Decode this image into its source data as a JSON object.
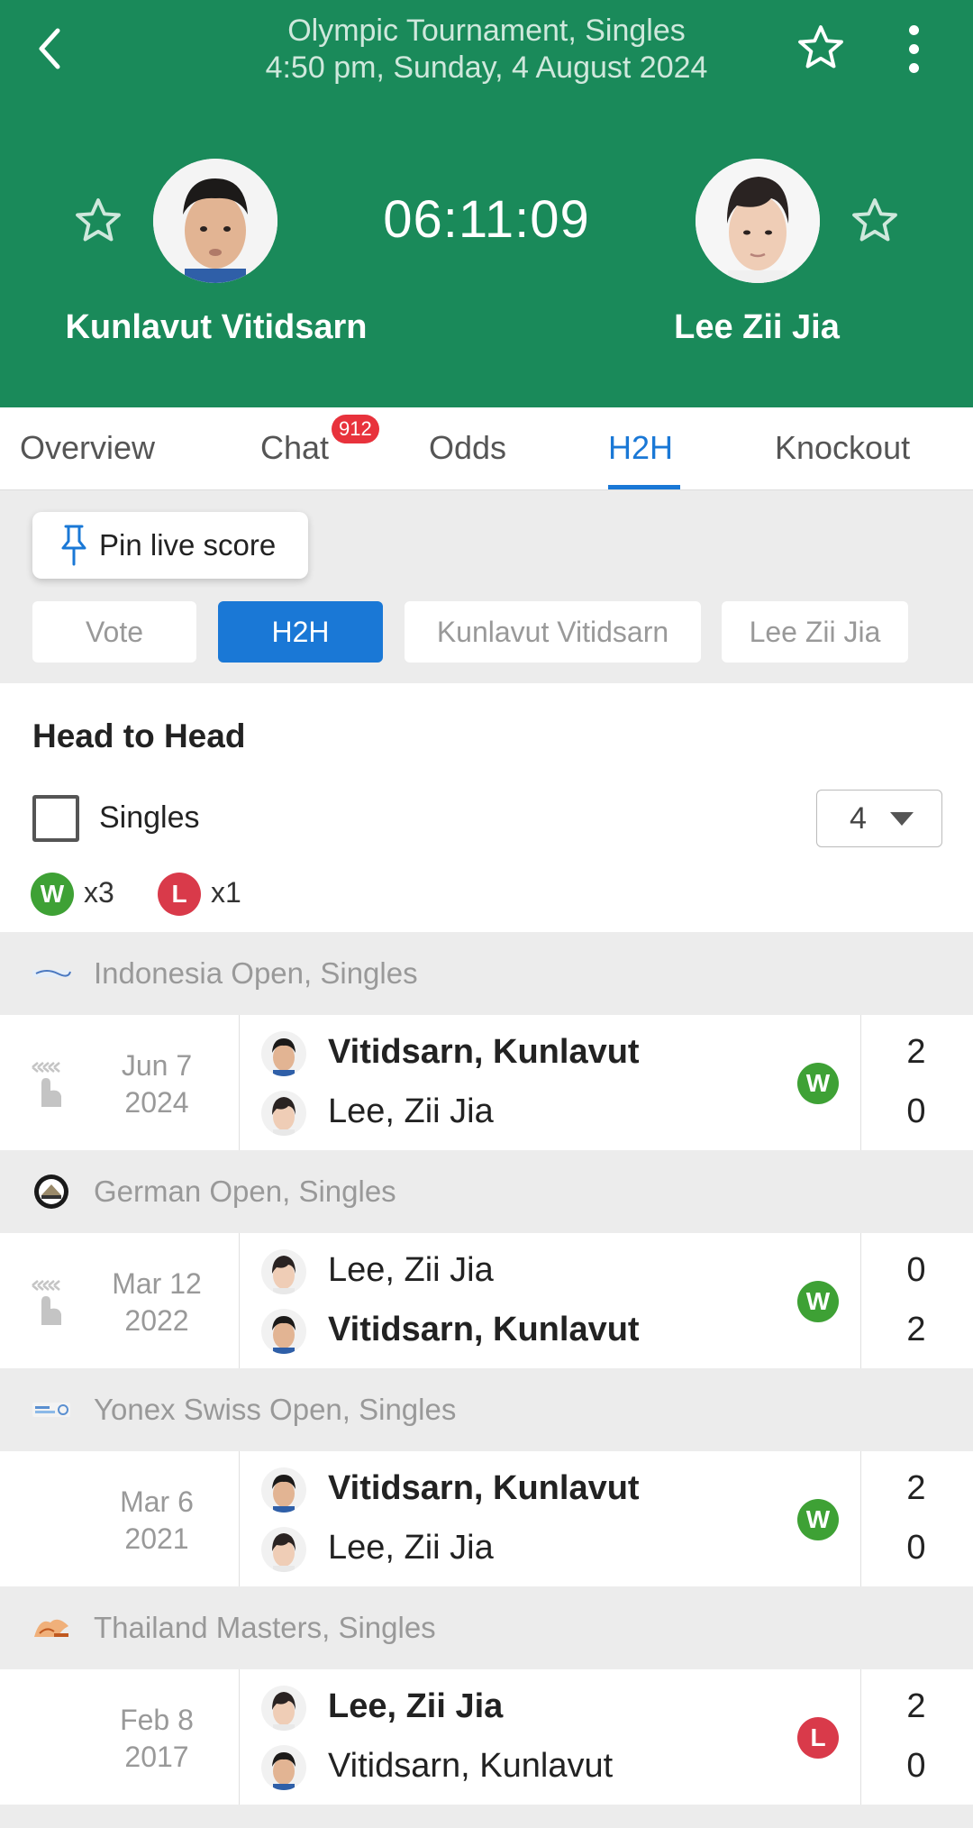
{
  "header": {
    "tournament_line": "Olympic Tournament, Singles",
    "datetime_line": "4:50 pm, Sunday, 4 August 2024",
    "countdown": "06:11:09",
    "player_left": "Kunlavut Vitidsarn",
    "player_right": "Lee Zii Jia",
    "colors": {
      "background": "#1a8a5a",
      "text": "#ffffff"
    },
    "icons": {
      "back": "back-arrow-icon",
      "favorite": "star-outline-icon",
      "more": "more-vertical-icon"
    }
  },
  "tabs": [
    {
      "label": "Overview",
      "active": false
    },
    {
      "label": "Chat",
      "active": false,
      "badge": "912"
    },
    {
      "label": "Odds",
      "active": false
    },
    {
      "label": "H2H",
      "active": true
    },
    {
      "label": "Knockout",
      "active": false
    }
  ],
  "pin_button": {
    "label": "Pin live score",
    "icon": "pin-icon"
  },
  "filter_chips": [
    {
      "label": "Vote",
      "active": false
    },
    {
      "label": "H2H",
      "active": true
    },
    {
      "label": "Kunlavut Vitidsarn",
      "active": false
    },
    {
      "label": "Lee Zii Jia",
      "active": false
    }
  ],
  "h2h": {
    "title": "Head to Head",
    "filter_label": "Singles",
    "filter_checked": false,
    "count_select": "4",
    "wins_badge": "W",
    "wins_count": "x3",
    "losses_badge": "L",
    "losses_count": "x1"
  },
  "matches": [
    {
      "tournament": "Indonesia Open, Singles",
      "date_line1": "Jun 7",
      "date_line2": "2024",
      "has_highlights_icon": true,
      "top_player": "Vitidsarn, Kunlavut",
      "top_score": "2",
      "top_winner": true,
      "bottom_player": "Lee, Zii Jia",
      "bottom_score": "0",
      "bottom_winner": false,
      "result": "W"
    },
    {
      "tournament": "German Open, Singles",
      "date_line1": "Mar 12",
      "date_line2": "2022",
      "has_highlights_icon": true,
      "top_player": "Lee, Zii Jia",
      "top_score": "0",
      "top_winner": false,
      "bottom_player": "Vitidsarn, Kunlavut",
      "bottom_score": "2",
      "bottom_winner": true,
      "result": "W"
    },
    {
      "tournament": "Yonex Swiss Open, Singles",
      "date_line1": "Mar 6",
      "date_line2": "2021",
      "has_highlights_icon": false,
      "top_player": "Vitidsarn, Kunlavut",
      "top_score": "2",
      "top_winner": true,
      "bottom_player": "Lee, Zii Jia",
      "bottom_score": "0",
      "bottom_winner": false,
      "result": "W"
    },
    {
      "tournament": "Thailand Masters, Singles",
      "date_line1": "Feb 8",
      "date_line2": "2017",
      "has_highlights_icon": false,
      "top_player": "Lee, Zii Jia",
      "top_score": "2",
      "top_winner": true,
      "bottom_player": "Vitidsarn, Kunlavut",
      "bottom_score": "0",
      "bottom_winner": false,
      "result": "L"
    }
  ],
  "colors": {
    "accent": "#1a78d6",
    "win": "#3ea135",
    "loss": "#d93a4a",
    "badge": "#e8323c"
  }
}
